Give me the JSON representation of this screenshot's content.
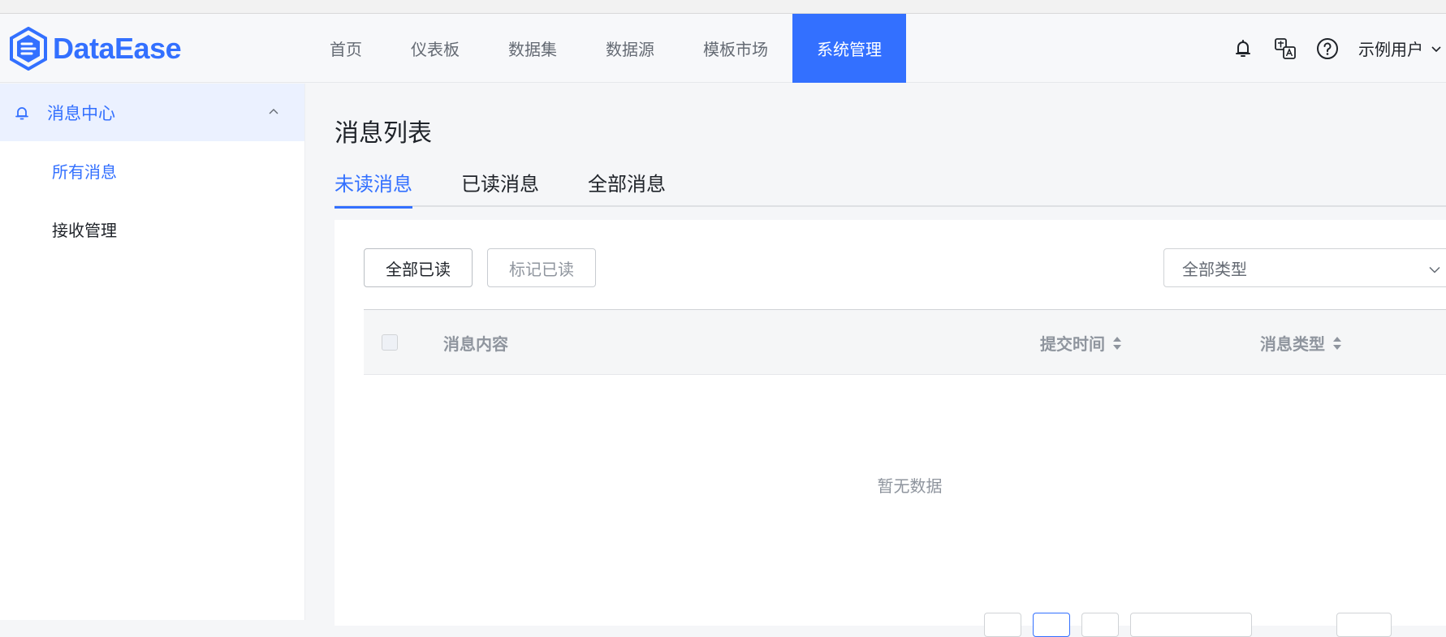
{
  "app": {
    "logo_text": "DataEase",
    "brand_color": "#3370ff"
  },
  "nav": {
    "items": [
      {
        "label": "首页",
        "active": false
      },
      {
        "label": "仪表板",
        "active": false
      },
      {
        "label": "数据集",
        "active": false
      },
      {
        "label": "数据源",
        "active": false
      },
      {
        "label": "模板市场",
        "active": false
      },
      {
        "label": "系统管理",
        "active": true
      }
    ]
  },
  "header_right": {
    "icons": [
      "notification-icon",
      "translate-icon",
      "help-icon"
    ],
    "user_name": "示例用户"
  },
  "sidebar": {
    "parent": {
      "label": "消息中心",
      "icon": "bell-icon",
      "expanded": true
    },
    "children": [
      {
        "label": "所有消息",
        "active": true
      },
      {
        "label": "接收管理",
        "active": false
      }
    ]
  },
  "main": {
    "title": "消息列表",
    "tabs": [
      {
        "label": "未读消息",
        "active": true
      },
      {
        "label": "已读消息",
        "active": false
      },
      {
        "label": "全部消息",
        "active": false
      }
    ],
    "toolbar": {
      "all_read_label": "全部已读",
      "mark_read_label": "标记已读",
      "type_filter_value": "全部类型"
    },
    "table": {
      "columns": [
        "消息内容",
        "提交时间",
        "消息类型"
      ],
      "rows": [],
      "empty_text": "暂无数据"
    }
  }
}
